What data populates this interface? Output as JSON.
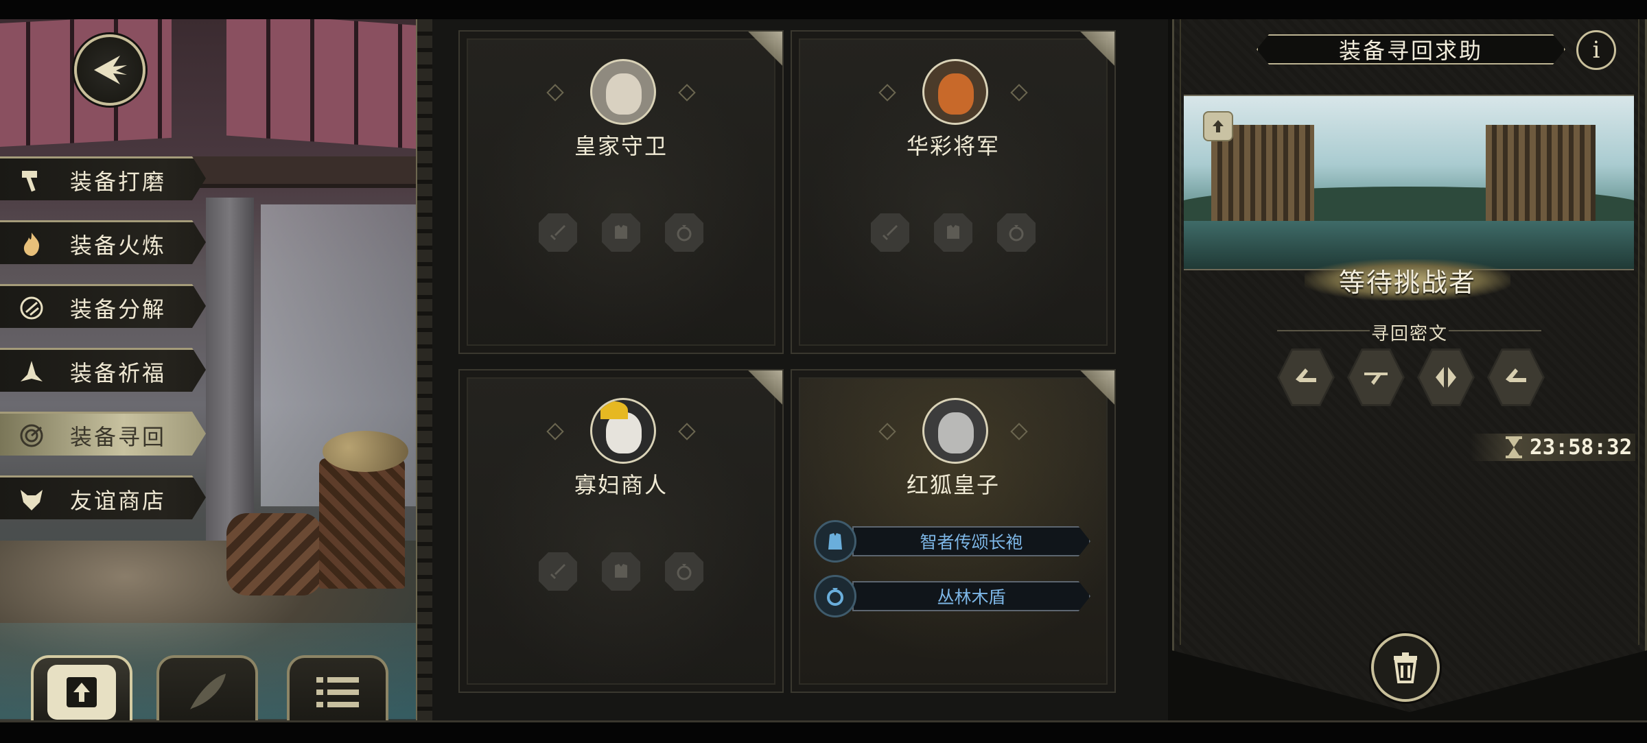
{
  "menu": {
    "items": [
      {
        "label": "装备打磨",
        "icon": "hammer-icon",
        "active": false
      },
      {
        "label": "装备火炼",
        "icon": "flame-icon",
        "active": false
      },
      {
        "label": "装备分解",
        "icon": "disassemble-icon",
        "active": false
      },
      {
        "label": "装备祈福",
        "icon": "praying-hands-icon",
        "active": false
      },
      {
        "label": "装备寻回",
        "icon": "target-icon",
        "active": true
      },
      {
        "label": "友谊商店",
        "icon": "fox-icon",
        "active": false
      }
    ]
  },
  "bottom_buttons": [
    {
      "icon": "upload-icon",
      "active": true
    },
    {
      "icon": "feather-icon",
      "active": false
    },
    {
      "icon": "list-icon",
      "active": false
    }
  ],
  "heroes": [
    {
      "name": "皇家守卫",
      "portrait": "royal-guard-portrait",
      "empty_slots": [
        "sword-slot-icon",
        "armor-slot-icon",
        "ring-slot-icon"
      ],
      "gear": []
    },
    {
      "name": "华彩将军",
      "portrait": "general-portrait",
      "empty_slots": [
        "sword-slot-icon",
        "armor-slot-icon",
        "ring-slot-icon"
      ],
      "gear": []
    },
    {
      "name": "寡妇商人",
      "portrait": "widow-merchant-portrait",
      "empty_slots": [
        "sword-slot-icon",
        "armor-slot-icon",
        "ring-slot-icon"
      ],
      "gear": []
    },
    {
      "name": "红狐皇子",
      "portrait": "red-fox-prince-portrait",
      "empty_slots": [],
      "gear": [
        {
          "label": "智者传颂长袍",
          "icon": "robe-icon"
        },
        {
          "label": "丛林木盾",
          "icon": "ring-icon"
        }
      ]
    }
  ],
  "right_panel": {
    "title": "装备寻回求助",
    "info_label": "i",
    "banner_status": "等待挑战者",
    "cipher_label": "寻回密文",
    "runes": [
      "rune-1-icon",
      "rune-2-icon",
      "rune-3-icon",
      "rune-4-icon"
    ],
    "timer": "23:58:32"
  },
  "colors": {
    "gold_border": "#c8bf9a",
    "gear_text": "#7db6e6",
    "panel_bg": "#1c1b18"
  }
}
